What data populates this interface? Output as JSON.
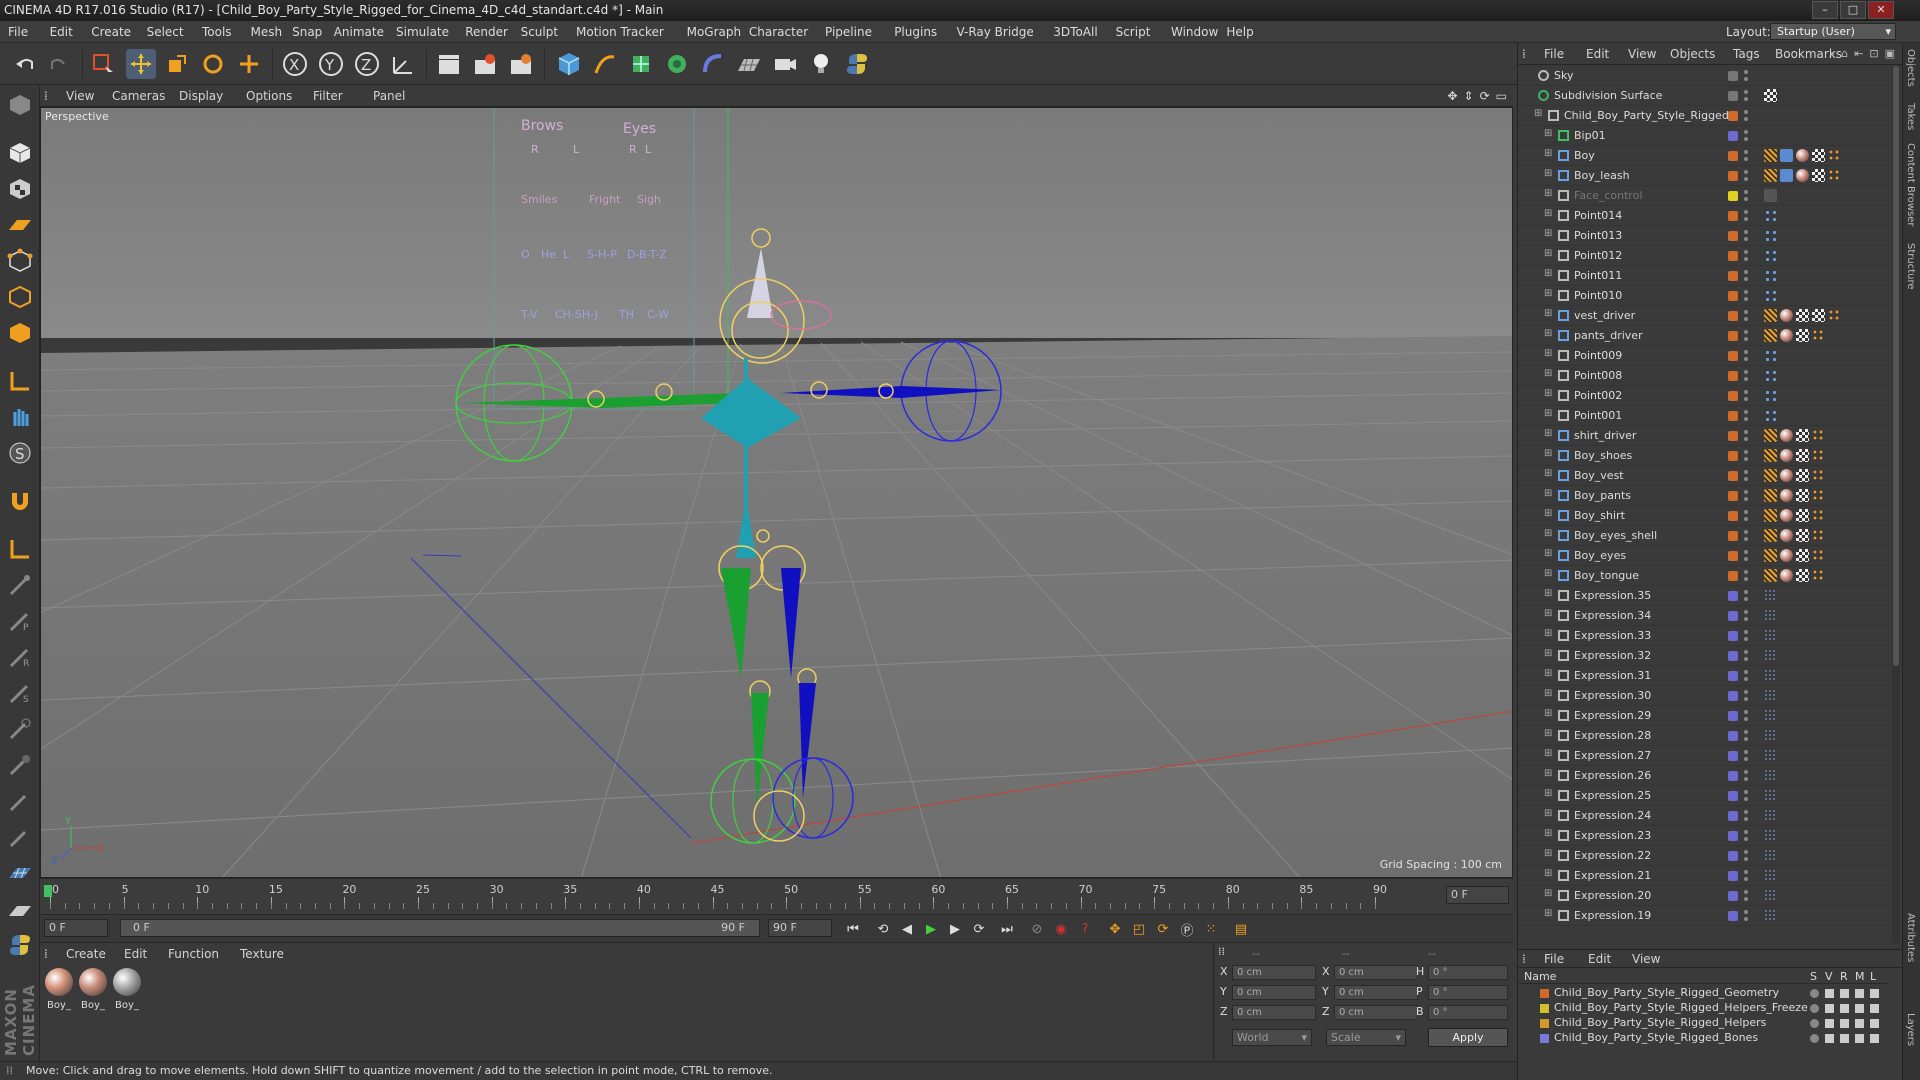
{
  "window": {
    "title": "CINEMA 4D R17.016 Studio (R17) - [Child_Boy_Party_Style_Rigged_for_Cinema_4D_c4d_standart.c4d *] - Main"
  },
  "menubar": {
    "items": [
      "File",
      "Edit",
      "Create",
      "Select",
      "Tools",
      "Mesh",
      "Snap",
      "Animate",
      "Simulate",
      "Render",
      "Sculpt",
      "Motion Tracker",
      "MoGraph",
      "Character",
      "Pipeline",
      "Plugins",
      "V-Ray Bridge",
      "3DToAll",
      "Script",
      "Window",
      "Help"
    ],
    "layout_label": "Layout:",
    "layout_value": "Startup (User)"
  },
  "viewport": {
    "menu": [
      "View",
      "Cameras",
      "Display",
      "Options",
      "Filter",
      "Panel"
    ],
    "label": "Perspective",
    "grid_spacing": "Grid Spacing : 100 cm",
    "axis_labels": {
      "x": "X",
      "y": "Y",
      "z": "Z"
    },
    "helper_text": [
      "Brows",
      "Eyes",
      "R",
      "L",
      "R",
      "L",
      "Smiles",
      "Fright",
      "Sigh",
      "O",
      "He",
      "L",
      "S-H-P",
      "D-B-T-Z",
      "T-V",
      "CH-SH-J",
      "TH",
      "C-W"
    ]
  },
  "timeline": {
    "ticks": [
      "0",
      "5",
      "10",
      "15",
      "20",
      "25",
      "30",
      "35",
      "40",
      "45",
      "50",
      "55",
      "60",
      "65",
      "70",
      "75",
      "80",
      "85",
      "90"
    ],
    "current_frame": "0 F"
  },
  "transport": {
    "start_field": "0 F",
    "range_start": "0 F",
    "range_end": "90 F",
    "end_field": "90 F"
  },
  "material_manager": {
    "menu": [
      "Create",
      "Edit",
      "Function",
      "Texture"
    ],
    "materials": [
      {
        "name": "Boy_",
        "color": "#d4907a"
      },
      {
        "name": "Boy_",
        "color": "#c88a78"
      },
      {
        "name": "Boy_",
        "color": "#a8a8a8"
      }
    ]
  },
  "coordinates": {
    "header": [
      "--",
      "--",
      "--"
    ],
    "rows": [
      {
        "a": "X",
        "av": "0 cm",
        "b": "X",
        "bv": "0 cm",
        "c": "H",
        "cv": "0 °"
      },
      {
        "a": "Y",
        "av": "0 cm",
        "b": "Y",
        "bv": "0 cm",
        "c": "P",
        "cv": "0 °"
      },
      {
        "a": "Z",
        "av": "0 cm",
        "b": "Z",
        "bv": "0 cm",
        "c": "B",
        "cv": "0 °"
      }
    ],
    "mode": "World",
    "scale": "Scale",
    "apply": "Apply"
  },
  "object_manager": {
    "menu": [
      "File",
      "Edit",
      "View",
      "Objects",
      "Tags",
      "Bookmarks"
    ],
    "objects": [
      {
        "name": "Sky",
        "indent": 0,
        "icon": "sky",
        "color": "#777777",
        "tags": []
      },
      {
        "name": "Subdivision Surface",
        "indent": 0,
        "icon": "subdiv",
        "color": "#777777",
        "tags": [
          "check"
        ]
      },
      {
        "name": "Child_Boy_Party_Style_Rigged",
        "indent": 1,
        "icon": "null",
        "color": "#d06a2a",
        "tags": []
      },
      {
        "name": "Bip01",
        "indent": 2,
        "icon": "bone",
        "color": "#6a6ad0",
        "tags": []
      },
      {
        "name": "Boy",
        "indent": 2,
        "icon": "mesh",
        "color": "#d06a2a",
        "tags": [
          "weight",
          "skin",
          "mat",
          "check",
          "dots"
        ]
      },
      {
        "name": "Boy_leash",
        "indent": 2,
        "icon": "mesh",
        "color": "#d06a2a",
        "tags": [
          "weight",
          "skin",
          "mat",
          "check",
          "dots"
        ]
      },
      {
        "name": "Face_control",
        "indent": 2,
        "icon": "null",
        "color": "#e0d020",
        "tags": [
          "xpresso"
        ]
      },
      {
        "name": "Point014",
        "indent": 2,
        "icon": "null",
        "color": "#d06a2a",
        "tags": [
          "xp"
        ]
      },
      {
        "name": "Point013",
        "indent": 2,
        "icon": "null",
        "color": "#d06a2a",
        "tags": [
          "xp"
        ]
      },
      {
        "name": "Point012",
        "indent": 2,
        "icon": "null",
        "color": "#d06a2a",
        "tags": [
          "xp"
        ]
      },
      {
        "name": "Point011",
        "indent": 2,
        "icon": "null",
        "color": "#d06a2a",
        "tags": [
          "xp"
        ]
      },
      {
        "name": "Point010",
        "indent": 2,
        "icon": "null",
        "color": "#d06a2a",
        "tags": [
          "xp"
        ]
      },
      {
        "name": "vest_driver",
        "indent": 2,
        "icon": "mesh",
        "color": "#d06a2a",
        "tags": [
          "weight",
          "mat",
          "check",
          "check",
          "dots"
        ]
      },
      {
        "name": "pants_driver",
        "indent": 2,
        "icon": "mesh",
        "color": "#d06a2a",
        "tags": [
          "weight",
          "mat",
          "check",
          "dots"
        ]
      },
      {
        "name": "Point009",
        "indent": 2,
        "icon": "null",
        "color": "#d06a2a",
        "tags": [
          "xp"
        ]
      },
      {
        "name": "Point008",
        "indent": 2,
        "icon": "null",
        "color": "#d06a2a",
        "tags": [
          "xp"
        ]
      },
      {
        "name": "Point002",
        "indent": 2,
        "icon": "null",
        "color": "#d06a2a",
        "tags": [
          "xp"
        ]
      },
      {
        "name": "Point001",
        "indent": 2,
        "icon": "null",
        "color": "#d06a2a",
        "tags": [
          "xp"
        ]
      },
      {
        "name": "shirt_driver",
        "indent": 2,
        "icon": "mesh",
        "color": "#d06a2a",
        "tags": [
          "weight",
          "mat",
          "check",
          "dots"
        ]
      },
      {
        "name": "Boy_shoes",
        "indent": 2,
        "icon": "mesh",
        "color": "#d06a2a",
        "tags": [
          "weight",
          "mat",
          "check",
          "dots"
        ]
      },
      {
        "name": "Boy_vest",
        "indent": 2,
        "icon": "mesh",
        "color": "#d06a2a",
        "tags": [
          "weight",
          "mat",
          "check",
          "dots"
        ]
      },
      {
        "name": "Boy_pants",
        "indent": 2,
        "icon": "mesh",
        "color": "#d06a2a",
        "tags": [
          "weight",
          "mat",
          "check",
          "dots"
        ]
      },
      {
        "name": "Boy_shirt",
        "indent": 2,
        "icon": "mesh",
        "color": "#d06a2a",
        "tags": [
          "weight",
          "mat",
          "check",
          "dots"
        ]
      },
      {
        "name": "Boy_eyes_shell",
        "indent": 2,
        "icon": "mesh",
        "color": "#d06a2a",
        "tags": [
          "weight",
          "mat",
          "check",
          "dots"
        ]
      },
      {
        "name": "Boy_eyes",
        "indent": 2,
        "icon": "mesh",
        "color": "#d06a2a",
        "tags": [
          "weight",
          "mat",
          "check",
          "dots"
        ]
      },
      {
        "name": "Boy_tongue",
        "indent": 2,
        "icon": "mesh",
        "color": "#d06a2a",
        "tags": [
          "weight",
          "mat",
          "check",
          "dots"
        ]
      },
      {
        "name": "Expression.35",
        "indent": 2,
        "icon": "null",
        "color": "#6a6ad0",
        "tags": [
          "xpd"
        ]
      },
      {
        "name": "Expression.34",
        "indent": 2,
        "icon": "null",
        "color": "#6a6ad0",
        "tags": [
          "xpd"
        ]
      },
      {
        "name": "Expression.33",
        "indent": 2,
        "icon": "null",
        "color": "#6a6ad0",
        "tags": [
          "xpd"
        ]
      },
      {
        "name": "Expression.32",
        "indent": 2,
        "icon": "null",
        "color": "#6a6ad0",
        "tags": [
          "xpd"
        ]
      },
      {
        "name": "Expression.31",
        "indent": 2,
        "icon": "null",
        "color": "#6a6ad0",
        "tags": [
          "xpd"
        ]
      },
      {
        "name": "Expression.30",
        "indent": 2,
        "icon": "null",
        "color": "#6a6ad0",
        "tags": [
          "xpd"
        ]
      },
      {
        "name": "Expression.29",
        "indent": 2,
        "icon": "null",
        "color": "#6a6ad0",
        "tags": [
          "xpd"
        ]
      },
      {
        "name": "Expression.28",
        "indent": 2,
        "icon": "null",
        "color": "#6a6ad0",
        "tags": [
          "xpd"
        ]
      },
      {
        "name": "Expression.27",
        "indent": 2,
        "icon": "null",
        "color": "#6a6ad0",
        "tags": [
          "xpd"
        ]
      },
      {
        "name": "Expression.26",
        "indent": 2,
        "icon": "null",
        "color": "#6a6ad0",
        "tags": [
          "xpd"
        ]
      },
      {
        "name": "Expression.25",
        "indent": 2,
        "icon": "null",
        "color": "#6a6ad0",
        "tags": [
          "xpd"
        ]
      },
      {
        "name": "Expression.24",
        "indent": 2,
        "icon": "null",
        "color": "#6a6ad0",
        "tags": [
          "xpd"
        ]
      },
      {
        "name": "Expression.23",
        "indent": 2,
        "icon": "null",
        "color": "#6a6ad0",
        "tags": [
          "xpd"
        ]
      },
      {
        "name": "Expression.22",
        "indent": 2,
        "icon": "null",
        "color": "#6a6ad0",
        "tags": [
          "xpd"
        ]
      },
      {
        "name": "Expression.21",
        "indent": 2,
        "icon": "null",
        "color": "#6a6ad0",
        "tags": [
          "xpd"
        ]
      },
      {
        "name": "Expression.20",
        "indent": 2,
        "icon": "null",
        "color": "#6a6ad0",
        "tags": [
          "xpd"
        ]
      },
      {
        "name": "Expression.19",
        "indent": 2,
        "icon": "null",
        "color": "#6a6ad0",
        "tags": [
          "xpd"
        ]
      }
    ]
  },
  "layer_manager": {
    "menu": [
      "File",
      "Edit",
      "View"
    ],
    "header": {
      "name": "Name",
      "cols": [
        "S",
        "V",
        "R",
        "M",
        "L"
      ]
    },
    "layers": [
      {
        "name": "Child_Boy_Party_Style_Rigged_Geometry",
        "color": "#d06a2a"
      },
      {
        "name": "Child_Boy_Party_Style_Rigged_Helpers_Freeze",
        "color": "#d0c02a"
      },
      {
        "name": "Child_Boy_Party_Style_Rigged_Helpers",
        "color": "#d09a2a"
      },
      {
        "name": "Child_Boy_Party_Style_Rigged_Bones",
        "color": "#7a7ad8"
      }
    ]
  },
  "side_tabs": [
    "Objects",
    "Takes",
    "Content Browser",
    "Structure",
    "Attributes",
    "Layers"
  ],
  "status": "Move: Click and drag to move elements. Hold down SHIFT to quantize movement / add to the selection in point mode, CTRL to remove.",
  "brand": "MAXON CINEMA 4D"
}
